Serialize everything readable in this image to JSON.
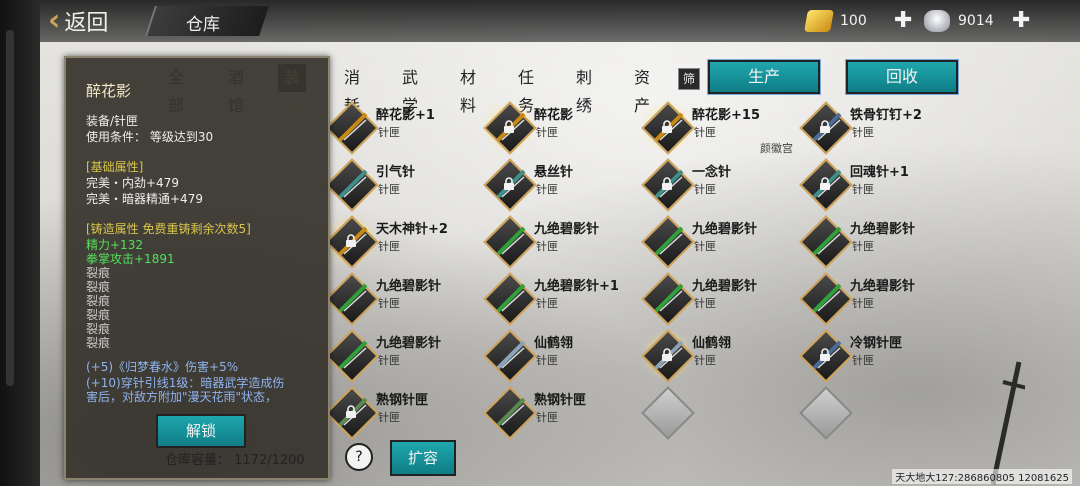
{
  "header": {
    "back_label": "返回",
    "title": "仓库",
    "gold": "100",
    "silver": "9014"
  },
  "tabs": [
    {
      "label": "全部",
      "active": false
    },
    {
      "label": "酒馆",
      "active": false
    },
    {
      "label": "装备",
      "active": true
    },
    {
      "label": "消耗",
      "active": false
    },
    {
      "label": "武学",
      "active": false
    },
    {
      "label": "材料",
      "active": false
    },
    {
      "label": "任务",
      "active": false
    },
    {
      "label": "刺绣",
      "active": false
    },
    {
      "label": "资产",
      "active": false
    }
  ],
  "filter_label": "筛",
  "buttons": {
    "produce": "生产",
    "recycle": "回收",
    "unlock": "解锁",
    "expand": "扩容",
    "help": "?"
  },
  "watermark": "颜徽宫",
  "items": [
    {
      "name": "醉花影+1",
      "type": "针匣",
      "locked": false,
      "glow": false,
      "color": "#c98a12"
    },
    {
      "name": "醉花影",
      "type": "针匣",
      "locked": true,
      "glow": true,
      "color": "#c98a12"
    },
    {
      "name": "醉花影+15",
      "type": "针匣",
      "locked": true,
      "glow": true,
      "color": "#c98a12"
    },
    {
      "name": "铁骨钉钉+2",
      "type": "针匣",
      "locked": true,
      "glow": false,
      "color": "#4b6b9a"
    },
    {
      "name": "引气针",
      "type": "针匣",
      "locked": false,
      "glow": false,
      "color": "#3d8f8a"
    },
    {
      "name": "悬丝针",
      "type": "针匣",
      "locked": true,
      "glow": false,
      "color": "#3d8f8a"
    },
    {
      "name": "一念针",
      "type": "针匣",
      "locked": true,
      "glow": false,
      "color": "#3d8f8a"
    },
    {
      "name": "回魂针+1",
      "type": "针匣",
      "locked": true,
      "glow": false,
      "color": "#3d8f8a"
    },
    {
      "name": "天木神针+2",
      "type": "针匣",
      "locked": true,
      "glow": true,
      "color": "#c98a12"
    },
    {
      "name": "九绝碧影针",
      "type": "针匣",
      "locked": false,
      "glow": false,
      "color": "#2fa03a"
    },
    {
      "name": "九绝碧影针",
      "type": "针匣",
      "locked": false,
      "glow": false,
      "color": "#2fa03a"
    },
    {
      "name": "九绝碧影针",
      "type": "针匣",
      "locked": false,
      "glow": false,
      "color": "#2fa03a"
    },
    {
      "name": "九绝碧影针",
      "type": "针匣",
      "locked": false,
      "glow": false,
      "color": "#2fa03a"
    },
    {
      "name": "九绝碧影针+1",
      "type": "针匣",
      "locked": false,
      "glow": false,
      "color": "#2fa03a"
    },
    {
      "name": "九绝碧影针",
      "type": "针匣",
      "locked": false,
      "glow": false,
      "color": "#2fa03a"
    },
    {
      "name": "九绝碧影针",
      "type": "针匣",
      "locked": false,
      "glow": false,
      "color": "#2fa03a"
    },
    {
      "name": "九绝碧影针",
      "type": "针匣",
      "locked": false,
      "glow": false,
      "color": "#2fa03a"
    },
    {
      "name": "仙鹤翎",
      "type": "针匣",
      "locked": false,
      "glow": false,
      "color": "#8aa3b8"
    },
    {
      "name": "仙鹤翎",
      "type": "针匣",
      "locked": true,
      "glow": true,
      "color": "#8aa3b8"
    },
    {
      "name": "冷钢针匣",
      "type": "针匣",
      "locked": true,
      "glow": false,
      "color": "#4b6b9a"
    },
    {
      "name": "熟钢针匣",
      "type": "针匣",
      "locked": true,
      "glow": false,
      "color": "#5a8a50"
    },
    {
      "name": "熟钢针匣",
      "type": "针匣",
      "locked": false,
      "glow": false,
      "color": "#5a8a50"
    },
    {
      "name": "",
      "type": "",
      "empty": true
    },
    {
      "name": "",
      "type": "",
      "empty": true
    }
  ],
  "tooltip": {
    "title": "醉花影",
    "category": "装备/针匣",
    "requirement": "使用条件：   等级达到30",
    "base_header": "[基础属性]",
    "base_lines": [
      "完美・内劲+479",
      "完美・暗器精通+479"
    ],
    "forge_header": "[铸造属性  免费重铸剩余次数5]",
    "forge_lines": [
      "精力+132",
      "拳掌攻击+1891"
    ],
    "cracks": [
      "裂痕",
      "裂痕",
      "裂痕",
      "裂痕",
      "裂痕",
      "裂痕"
    ],
    "effect_lines": [
      "(+5)《归梦春水》伤害+5%",
      "(+10)穿针引线1级：暗器武学造成伤",
      "害后，对敌方附加\"漫天花雨\"状态，"
    ]
  },
  "capacity": "仓库容量：  1172/1200",
  "server_info": "天大地大127:286860805  12081625"
}
